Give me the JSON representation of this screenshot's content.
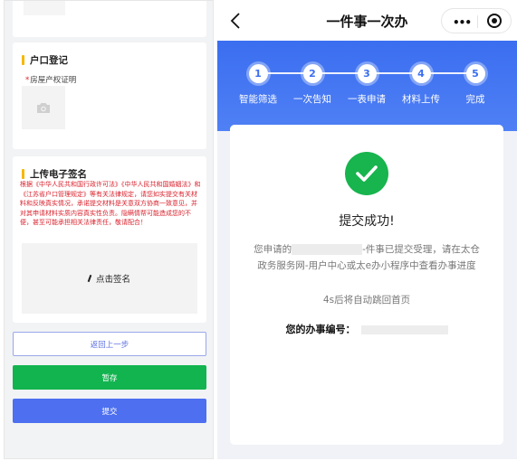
{
  "left": {
    "hukou": {
      "title": "户口登记",
      "required_star": "*",
      "field_label": "房屋产权证明",
      "upload_icon": "camera-icon"
    },
    "sign": {
      "title": "上传电子签名",
      "notice": "根据《中华人民共和国行政许可法》《中华人民共和国婚姻法》和《江苏省户口管理规定》等有关法律规定，请您如实提交有关材料和反映真实情况，承诺提交材料是关意双方协商一致意见，并对其申请材料实质内容真实性负责。隐瞒情帮可能造成您的不便，甚至可能承担相关法律责任，敬请配合！",
      "pad_label": "点击签名",
      "pad_icon": "pen-icon"
    },
    "buttons": {
      "back": "返回上一步",
      "save": "暂存",
      "submit": "提交"
    },
    "colors": {
      "accent_bar": "#f5b800",
      "notice": "#d9232e",
      "save": "#12b44f",
      "submit": "#4d6ff0"
    }
  },
  "right": {
    "nav": {
      "title": "一件事一次办",
      "back_icon": "chevron-left-icon",
      "more_icon": "more-dots-icon",
      "target_icon": "target-icon"
    },
    "steps": [
      {
        "num": "1",
        "label": "智能筛选"
      },
      {
        "num": "2",
        "label": "一次告知"
      },
      {
        "num": "3",
        "label": "一表申请"
      },
      {
        "num": "4",
        "label": "材料上传"
      },
      {
        "num": "5",
        "label": "完成"
      }
    ],
    "result": {
      "icon": "check-circle-icon",
      "title": "提交成功!",
      "msg_prefix": "您申请的",
      "msg_suffix": "-件事已提交受理，请在太仓政务服务网-用户中心或太e办小程序中查看办事进度",
      "countdown": "4s后将自动跳回首页",
      "number_label": "您的办事编号："
    },
    "colors": {
      "banner": "#3b6ef0",
      "success": "#18b44e"
    }
  }
}
